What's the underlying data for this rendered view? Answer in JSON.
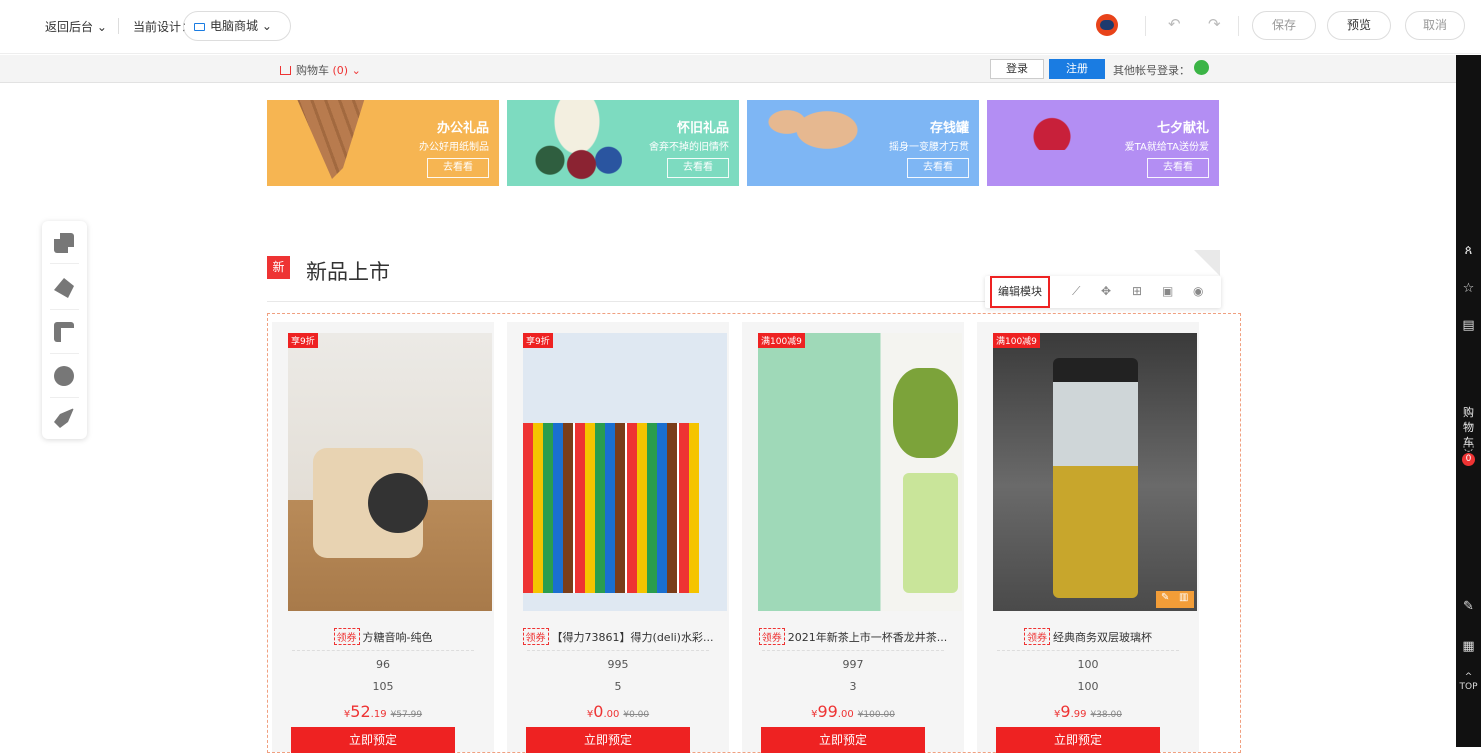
{
  "topbar": {
    "back": "返回后台",
    "current_label": "当前设计：",
    "design_select": "电脑商城",
    "save": "保存",
    "preview": "预览",
    "cancel": "取消"
  },
  "shopbar": {
    "cart": "购物车",
    "cart_count": "(0)",
    "login": "登录",
    "register": "注册",
    "other_login": "其他帐号登录："
  },
  "banners": [
    {
      "title": "办公礼品",
      "sub": "办公好用纸制品",
      "button": "去看看",
      "color": "#f6b552"
    },
    {
      "title": "怀旧礼品",
      "sub": "舍弃不掉的旧情怀",
      "button": "去看看",
      "color": "#7ddbc0"
    },
    {
      "title": "存钱罐",
      "sub": "摇身一变腰才万贯",
      "button": "去看看",
      "color": "#7eb6f4"
    },
    {
      "title": "七夕献礼",
      "sub": "爱TA就给TA送份爱",
      "button": "去看看",
      "color": "#b38ef3"
    }
  ],
  "section": {
    "title": "新品上市",
    "edit_module": "编辑模块"
  },
  "products": [
    {
      "tag": "享9折",
      "coupon": "领券",
      "name": "方糖音响-纯色",
      "v1": "96",
      "v2": "105",
      "currency": "¥",
      "price_int": "52",
      "price_dec": ".19",
      "old_price": "¥57.99",
      "button": "立即预定"
    },
    {
      "tag": "享9折",
      "coupon": "领券",
      "name": "【得力73861】得力(deli)水彩...",
      "v1": "995",
      "v2": "5",
      "currency": "¥",
      "price_int": "0",
      "price_dec": ".00",
      "old_price": "¥0.00",
      "button": "立即预定"
    },
    {
      "tag": "满100减9",
      "coupon": "领券",
      "name": "2021年新茶上市一杯香龙井茶...",
      "v1": "997",
      "v2": "3",
      "currency": "¥",
      "price_int": "99",
      "price_dec": ".00",
      "old_price": "¥100.00",
      "button": "立即预定"
    },
    {
      "tag": "满100减9",
      "coupon": "领券",
      "name": "经典商务双层玻璃杯",
      "v1": "100",
      "v2": "100",
      "currency": "¥",
      "price_int": "9",
      "price_dec": ".99",
      "old_price": "¥38.00",
      "button": "立即预定"
    }
  ],
  "rightbar": {
    "cart_label": "购物车",
    "cart_count": "0",
    "top": "TOP"
  }
}
